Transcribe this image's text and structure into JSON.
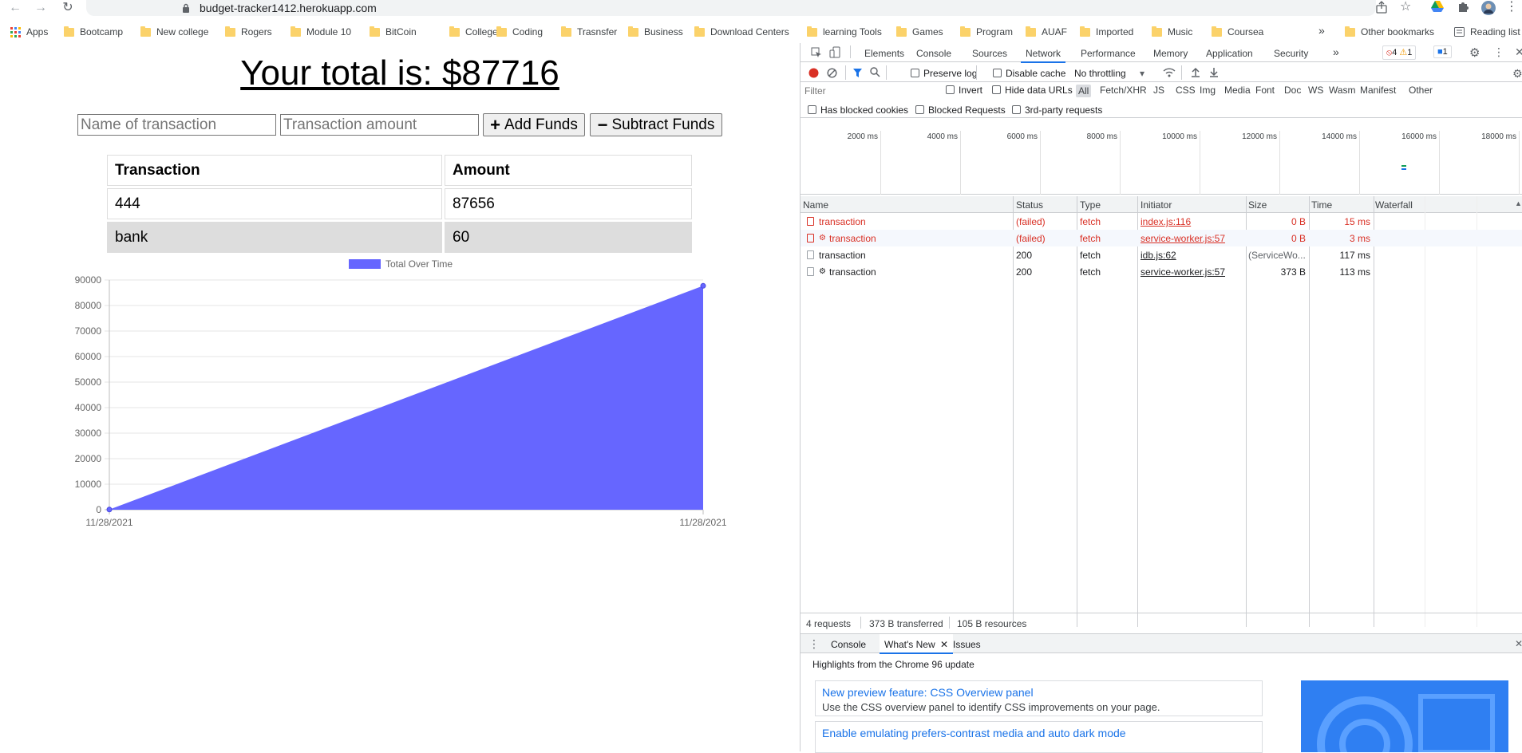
{
  "browser": {
    "url": "budget-tracker1412.herokuapp.com",
    "bookmarks": [
      {
        "label": "Apps",
        "icon": "apps-grid-icon"
      },
      {
        "label": "Bootcamp",
        "icon": "folder-icon"
      },
      {
        "label": "New college",
        "icon": "folder-icon"
      },
      {
        "label": "Rogers",
        "icon": "folder-icon"
      },
      {
        "label": "Module 10",
        "icon": "folder-icon"
      },
      {
        "label": "BitCoin",
        "icon": "folder-icon"
      },
      {
        "label": "College",
        "icon": "folder-icon"
      },
      {
        "label": "Coding",
        "icon": "folder-icon"
      },
      {
        "label": "Trasnsfer",
        "icon": "folder-icon"
      },
      {
        "label": "Business",
        "icon": "folder-icon"
      },
      {
        "label": "Download Centers",
        "icon": "folder-icon"
      },
      {
        "label": "learning Tools",
        "icon": "folder-icon"
      },
      {
        "label": "Games",
        "icon": "folder-icon"
      },
      {
        "label": "Program",
        "icon": "folder-icon"
      },
      {
        "label": "AUAF",
        "icon": "folder-icon"
      },
      {
        "label": "Imported",
        "icon": "folder-icon"
      },
      {
        "label": "Music",
        "icon": "folder-icon"
      },
      {
        "label": "Coursea",
        "icon": "folder-icon"
      }
    ],
    "more_bookmarks": "»",
    "other_bookmarks": "Other bookmarks",
    "reading_list": "Reading list"
  },
  "app": {
    "total_text": "Your total is: $87716",
    "name_placeholder": "Name of transaction",
    "amount_placeholder": "Transaction amount",
    "add_label": "Add Funds",
    "subtract_label": "Subtract Funds",
    "table_headers": [
      "Transaction",
      "Amount"
    ],
    "transactions": [
      {
        "name": "444",
        "amount": "87656"
      },
      {
        "name": "bank",
        "amount": "60"
      }
    ]
  },
  "chart_data": {
    "type": "area",
    "legend": "Total Over Time",
    "legend_position": "top",
    "color": "#6666ff",
    "x": [
      "11/28/2021",
      "11/28/2021"
    ],
    "series": [
      {
        "name": "Total Over Time",
        "values": [
          60,
          87716
        ]
      }
    ],
    "ylim": [
      0,
      90000
    ],
    "yticks": [
      0,
      10000,
      20000,
      30000,
      40000,
      50000,
      60000,
      70000,
      80000,
      90000
    ],
    "grid": true
  },
  "devtools": {
    "tabs": [
      "Elements",
      "Console",
      "Sources",
      "Network",
      "Performance",
      "Memory",
      "Application",
      "Security",
      "»"
    ],
    "active_tab": "Network",
    "errors_count": "4",
    "warnings_count": "1",
    "messages_count": "1",
    "toolbar": {
      "preserve_log": "Preserve log",
      "disable_cache": "Disable cache",
      "throttling": "No throttling"
    },
    "filter": {
      "placeholder": "Filter",
      "invert": "Invert",
      "hide_data_urls": "Hide data URLs",
      "types": [
        "All",
        "Fetch/XHR",
        "JS",
        "CSS",
        "Img",
        "Media",
        "Font",
        "Doc",
        "WS",
        "Wasm",
        "Manifest",
        "Other"
      ],
      "has_blocked_cookies": "Has blocked cookies",
      "blocked_requests": "Blocked Requests",
      "third_party": "3rd-party requests"
    },
    "timeline_ticks": [
      "2000 ms",
      "4000 ms",
      "6000 ms",
      "8000 ms",
      "10000 ms",
      "12000 ms",
      "14000 ms",
      "16000 ms",
      "18000 ms"
    ],
    "columns": [
      "Name",
      "Status",
      "Type",
      "Initiator",
      "Size",
      "Time",
      "Waterfall"
    ],
    "requests": [
      {
        "name": "transaction",
        "status": "(failed)",
        "type": "fetch",
        "initiator": "index.js:116",
        "size": "0 B",
        "time": "15 ms",
        "error": true,
        "sw": false
      },
      {
        "name": "transaction",
        "status": "(failed)",
        "type": "fetch",
        "initiator": "service-worker.js:57",
        "size": "0 B",
        "time": "3 ms",
        "error": true,
        "sw": true
      },
      {
        "name": "transaction",
        "status": "200",
        "type": "fetch",
        "initiator": "idb.js:62",
        "size": "(ServiceWo...",
        "time": "117 ms",
        "error": false,
        "sw": false
      },
      {
        "name": "transaction",
        "status": "200",
        "type": "fetch",
        "initiator": "service-worker.js:57",
        "size": "373 B",
        "time": "113 ms",
        "error": false,
        "sw": true
      }
    ],
    "summary": {
      "requests": "4 requests",
      "transferred": "373 B transferred",
      "resources": "105 B resources"
    },
    "drawer_tabs": [
      "Console",
      "What's New",
      "Issues"
    ],
    "drawer_active": "What's New",
    "drawer_heading": "Highlights from the Chrome 96 update",
    "news": [
      {
        "title": "New preview feature: CSS Overview panel",
        "desc": "Use the CSS overview panel to identify CSS improvements on your page."
      },
      {
        "title": "Enable emulating prefers-contrast media and auto dark mode",
        "desc": ""
      }
    ]
  }
}
